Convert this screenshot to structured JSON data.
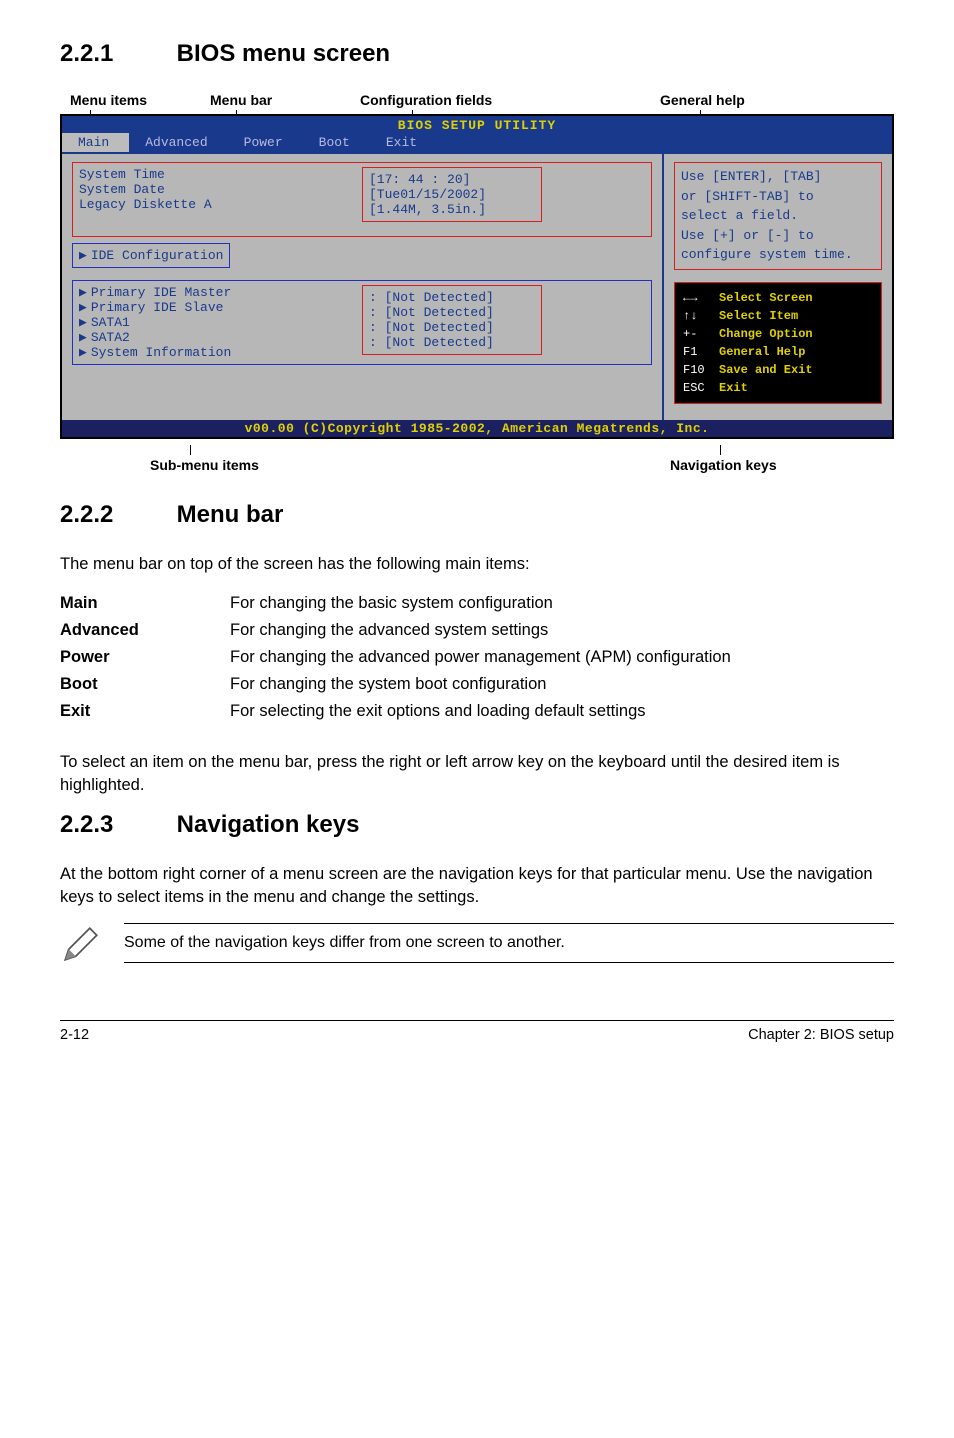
{
  "sections": {
    "s1": {
      "num": "2.2.1",
      "title": "BIOS menu screen"
    },
    "s2": {
      "num": "2.2.2",
      "title": "Menu bar"
    },
    "s3": {
      "num": "2.2.3",
      "title": "Navigation keys"
    }
  },
  "labels": {
    "menu_items": "Menu items",
    "menu_bar": "Menu bar",
    "config_fields": "Configuration fields",
    "general_help": "General help",
    "sub_menu": "Sub-menu items",
    "nav_keys": "Navigation keys"
  },
  "bios": {
    "title": "BIOS SETUP UTILITY",
    "menubar": [
      "Main",
      "Advanced",
      "Power",
      "Boot",
      "Exit"
    ],
    "fields": {
      "system_time": {
        "label": "System Time",
        "value": "[17: 44 : 20]"
      },
      "system_date": {
        "label": "System Date",
        "value": "[Tue01/15/2002]"
      },
      "legacy_diskette": {
        "label": "Legacy Diskette A",
        "value": "[1.44M, 3.5in.]"
      },
      "ide_config": "IDE Configuration",
      "pri_master": {
        "label": "Primary IDE Master",
        "value": ": [Not Detected]"
      },
      "pri_slave": {
        "label": "Primary IDE Slave",
        "value": ": [Not Detected]"
      },
      "sata1": {
        "label": "SATA1",
        "value": ": [Not Detected]"
      },
      "sata2": {
        "label": "SATA2",
        "value": ": [Not Detected]"
      },
      "sysinfo": "System Information"
    },
    "help": "Use [ENTER], [TAB]\nor [SHIFT-TAB] to\nselect a field.\nUse [+] or [-] to\nconfigure system time.",
    "navkeys": [
      {
        "k": "←→",
        "d": "Select Screen"
      },
      {
        "k": "↑↓",
        "d": "Select Item"
      },
      {
        "k": "+-",
        "d": "Change Option"
      },
      {
        "k": "F1",
        "d": "General Help"
      },
      {
        "k": "F10",
        "d": "Save and Exit"
      },
      {
        "k": "ESC",
        "d": "Exit"
      }
    ],
    "footer": "v00.00 (C)Copyright 1985-2002, American Megatrends, Inc."
  },
  "menubar_text": {
    "intro": "The menu bar on top of the screen has the following main items:",
    "defs": [
      {
        "term": "Main",
        "desc": "For changing the basic system configuration"
      },
      {
        "term": "Advanced",
        "desc": "For changing the advanced system settings"
      },
      {
        "term": "Power",
        "desc": "For changing the advanced power management (APM) configuration"
      },
      {
        "term": "Boot",
        "desc": "For changing the system boot configuration"
      },
      {
        "term": "Exit",
        "desc": "For selecting the exit options and loading default settings"
      }
    ],
    "tail": "To select an item on the menu bar, press the right or left arrow key on the keyboard until the desired item is highlighted."
  },
  "navkeys_text": {
    "p1": "At the bottom right corner of a menu screen are the navigation keys for that particular menu. Use the navigation keys to select items in the menu and change the settings.",
    "note": "Some of the navigation keys differ from one screen to another."
  },
  "footer": {
    "left": "2-12",
    "right": "Chapter 2: BIOS setup"
  }
}
